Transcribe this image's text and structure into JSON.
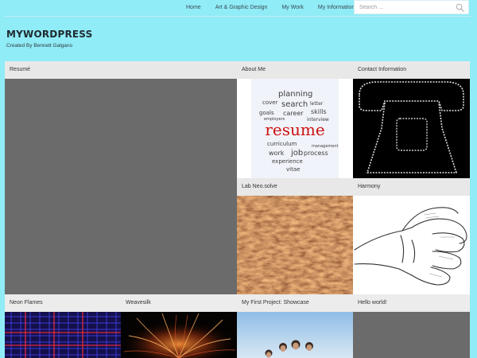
{
  "nav": {
    "items": [
      {
        "label": "Home"
      },
      {
        "label": "Art & Graphic Design"
      },
      {
        "label": "My Work"
      },
      {
        "label": "My Information"
      }
    ],
    "search_placeholder": "Search ..."
  },
  "header": {
    "site_title": "MYWORDPRESS",
    "tagline": "Created By Bennett Galgano"
  },
  "tiles": [
    {
      "label": "Resumé"
    },
    {
      "label": "About Me"
    },
    {
      "label": "Contact Information"
    },
    {
      "label": "Lab Neo.solve"
    },
    {
      "label": "Harmony"
    },
    {
      "label": "Neon Flames"
    },
    {
      "label": "Weavesilk"
    },
    {
      "label": "My First Project: Showcase"
    },
    {
      "label": "Hello world!"
    }
  ],
  "about_image_word": "resume",
  "about_image_words": [
    "planning",
    "cover",
    "search",
    "letter",
    "goals",
    "career",
    "skills",
    "employers",
    "interview",
    "curriculum",
    "work",
    "job",
    "process",
    "experience",
    "vitae",
    "management"
  ],
  "colors": {
    "background": "#90ecf7",
    "tile_label_bg": "#e8e8e8",
    "placeholder_gray": "#6b6b6b",
    "resume_red": "#cc1111"
  }
}
